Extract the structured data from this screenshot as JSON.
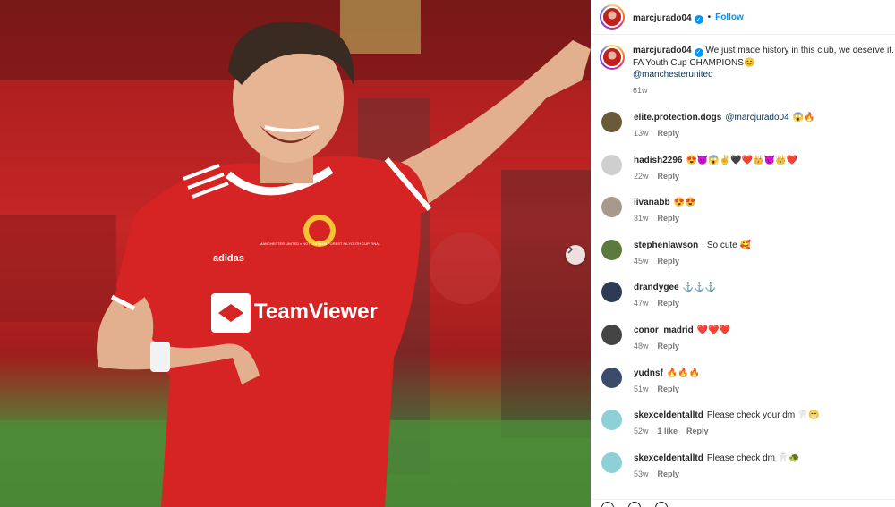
{
  "post": {
    "username": "marcjurado04",
    "verified_mark": "✓",
    "separator": "•",
    "follow_label": "Follow",
    "caption": {
      "username": "marcjurado04",
      "text": "We just made history in this club, we deserve it. FA Youth Cup CHAMPIONS😊",
      "mention": "@manchesterunited",
      "time": "61w"
    },
    "photo": {
      "jersey_sponsor": "TeamViewer",
      "jersey_brand": "adidas",
      "jersey_print": "MANCHESTER UNITED v NOTTINGHAM FOREST FA YOUTH CUP FINAL"
    },
    "next_icon": "chevron-right-icon"
  },
  "comments": [
    {
      "user": "elite.protection.dogs",
      "mention": "@marcjurado04",
      "text": "😱🔥",
      "time": "13w",
      "likes": "",
      "reply": "Reply",
      "avatar_color": "#6b5a3a"
    },
    {
      "user": "hadish2296",
      "mention": "",
      "text": "😍😈😱✌️🖤❤️👑😈👑❤️",
      "time": "22w",
      "likes": "",
      "reply": "Reply",
      "avatar_color": "#cfcfcf"
    },
    {
      "user": "iivanabb",
      "mention": "",
      "text": "😍😍",
      "time": "31w",
      "likes": "",
      "reply": "Reply",
      "avatar_color": "#a79a8c"
    },
    {
      "user": "stephenlawson_",
      "mention": "",
      "text": "So cute 🥰",
      "time": "45w",
      "likes": "",
      "reply": "Reply",
      "avatar_color": "#5b7a3e"
    },
    {
      "user": "drandygee",
      "mention": "",
      "text": "⚓⚓⚓",
      "time": "47w",
      "likes": "",
      "reply": "Reply",
      "avatar_color": "#2d3b55"
    },
    {
      "user": "conor_madrid",
      "mention": "",
      "text": "❤️❤️❤️",
      "time": "48w",
      "likes": "",
      "reply": "Reply",
      "avatar_color": "#444444"
    },
    {
      "user": "yudnsf",
      "mention": "",
      "text": "🔥🔥🔥",
      "time": "51w",
      "likes": "",
      "reply": "Reply",
      "avatar_color": "#3b4c6b"
    },
    {
      "user": "skexceldentalltd",
      "mention": "",
      "text": "Please check your dm 🦷😁",
      "time": "52w",
      "likes": "1 like",
      "reply": "Reply",
      "avatar_color": "#8fd0d6"
    },
    {
      "user": "skexceldentalltd",
      "mention": "",
      "text": "Please check dm 🦷🐢",
      "time": "53w",
      "likes": "",
      "reply": "Reply",
      "avatar_color": "#8fd0d6"
    }
  ]
}
